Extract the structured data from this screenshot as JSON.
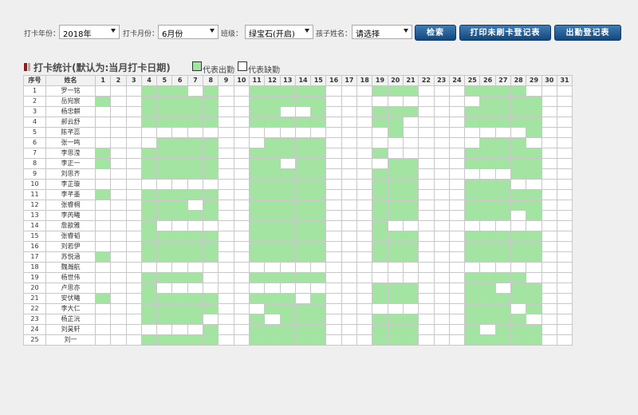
{
  "filters": {
    "year": {
      "label": "打卡年份：",
      "value": "2018年"
    },
    "month": {
      "label": "打卡月份：",
      "value": "6月份"
    },
    "class": {
      "label": "班级：",
      "value": "绿宝石(开启)"
    },
    "child": {
      "label": "孩子姓名：",
      "value": "请选择"
    }
  },
  "buttons": {
    "search": "检索",
    "print_unchecked": "打印未刷卡登记表",
    "attendance_register": "出勤登记表"
  },
  "title": "打卡统计(默认为:当月打卡日期)",
  "legend": {
    "present": "代表出勤",
    "absent": "代表缺勤"
  },
  "colors": {
    "present": "#a3e4a3",
    "absent": "#ffffff"
  },
  "table": {
    "header_index": "序号",
    "header_name": "姓名",
    "days": [
      "1",
      "2",
      "3",
      "4",
      "5",
      "6",
      "7",
      "8",
      "9",
      "10",
      "11",
      "12",
      "13",
      "14",
      "15",
      "16",
      "17",
      "18",
      "19",
      "20",
      "21",
      "22",
      "23",
      "24",
      "25",
      "26",
      "27",
      "28",
      "29",
      "30",
      "31"
    ],
    "rows": [
      {
        "no": "1",
        "name": "罗一铭",
        "days": [
          0,
          0,
          0,
          1,
          1,
          1,
          0,
          1,
          0,
          0,
          1,
          1,
          1,
          1,
          1,
          0,
          0,
          0,
          1,
          1,
          1,
          0,
          0,
          0,
          1,
          1,
          1,
          1,
          0,
          0,
          0
        ]
      },
      {
        "no": "2",
        "name": "岳宛宸",
        "days": [
          1,
          0,
          0,
          1,
          1,
          1,
          1,
          1,
          0,
          0,
          1,
          1,
          1,
          1,
          1,
          0,
          0,
          0,
          0,
          0,
          0,
          0,
          0,
          0,
          0,
          1,
          1,
          1,
          1,
          0,
          0
        ]
      },
      {
        "no": "3",
        "name": "杨忠麒",
        "days": [
          0,
          0,
          0,
          1,
          1,
          1,
          1,
          1,
          0,
          0,
          1,
          1,
          0,
          0,
          1,
          0,
          0,
          0,
          1,
          1,
          1,
          0,
          0,
          0,
          1,
          1,
          1,
          1,
          1,
          0,
          0
        ]
      },
      {
        "no": "4",
        "name": "郝云舒",
        "days": [
          0,
          0,
          0,
          1,
          1,
          1,
          1,
          1,
          0,
          0,
          1,
          1,
          1,
          1,
          1,
          0,
          0,
          0,
          1,
          1,
          0,
          0,
          0,
          0,
          1,
          1,
          1,
          1,
          1,
          0,
          0
        ]
      },
      {
        "no": "5",
        "name": "陈芊蕊",
        "days": [
          0,
          0,
          0,
          0,
          0,
          0,
          0,
          0,
          0,
          0,
          0,
          0,
          0,
          0,
          0,
          0,
          0,
          0,
          0,
          1,
          0,
          0,
          0,
          0,
          0,
          0,
          0,
          0,
          1,
          0,
          0
        ]
      },
      {
        "no": "6",
        "name": "张一鸣",
        "days": [
          0,
          0,
          0,
          0,
          1,
          1,
          1,
          1,
          0,
          0,
          0,
          1,
          1,
          1,
          1,
          0,
          0,
          0,
          0,
          0,
          0,
          0,
          0,
          0,
          0,
          1,
          1,
          1,
          0,
          0,
          0
        ]
      },
      {
        "no": "7",
        "name": "李思滢",
        "days": [
          1,
          0,
          0,
          1,
          1,
          1,
          1,
          1,
          0,
          0,
          1,
          1,
          1,
          1,
          1,
          0,
          0,
          0,
          1,
          0,
          0,
          0,
          0,
          0,
          1,
          1,
          1,
          1,
          1,
          0,
          0
        ]
      },
      {
        "no": "8",
        "name": "李正一",
        "days": [
          1,
          0,
          0,
          1,
          1,
          1,
          1,
          1,
          0,
          0,
          1,
          1,
          0,
          1,
          1,
          0,
          0,
          0,
          0,
          1,
          1,
          0,
          0,
          0,
          1,
          1,
          1,
          1,
          1,
          0,
          0
        ]
      },
      {
        "no": "9",
        "name": "刘思齐",
        "days": [
          0,
          0,
          0,
          1,
          1,
          1,
          1,
          1,
          0,
          0,
          1,
          1,
          1,
          1,
          1,
          0,
          0,
          0,
          1,
          1,
          1,
          0,
          0,
          0,
          0,
          0,
          0,
          1,
          1,
          0,
          0
        ]
      },
      {
        "no": "10",
        "name": "李芷璇",
        "days": [
          0,
          0,
          0,
          0,
          0,
          0,
          0,
          0,
          0,
          0,
          1,
          1,
          1,
          1,
          1,
          0,
          0,
          0,
          1,
          1,
          1,
          0,
          0,
          0,
          1,
          1,
          1,
          0,
          0,
          0,
          0
        ]
      },
      {
        "no": "11",
        "name": "李芊墨",
        "days": [
          1,
          0,
          0,
          1,
          1,
          1,
          1,
          1,
          0,
          0,
          1,
          1,
          1,
          1,
          1,
          0,
          0,
          0,
          1,
          1,
          1,
          0,
          0,
          0,
          1,
          1,
          1,
          1,
          1,
          0,
          0
        ]
      },
      {
        "no": "12",
        "name": "张睿桐",
        "days": [
          0,
          0,
          0,
          1,
          1,
          1,
          0,
          1,
          0,
          0,
          1,
          1,
          1,
          1,
          1,
          0,
          0,
          0,
          1,
          1,
          1,
          0,
          0,
          0,
          1,
          1,
          1,
          1,
          1,
          0,
          0
        ]
      },
      {
        "no": "13",
        "name": "李芮曦",
        "days": [
          0,
          0,
          0,
          1,
          1,
          1,
          1,
          1,
          0,
          0,
          1,
          1,
          1,
          1,
          1,
          0,
          0,
          0,
          1,
          1,
          1,
          0,
          0,
          0,
          1,
          1,
          1,
          0,
          1,
          0,
          0
        ]
      },
      {
        "no": "14",
        "name": "詹歆雅",
        "days": [
          0,
          0,
          0,
          1,
          0,
          0,
          0,
          0,
          0,
          0,
          1,
          1,
          1,
          1,
          1,
          0,
          0,
          0,
          1,
          0,
          0,
          0,
          0,
          0,
          0,
          0,
          0,
          0,
          0,
          0,
          0
        ]
      },
      {
        "no": "15",
        "name": "张睿韬",
        "days": [
          0,
          0,
          0,
          1,
          1,
          1,
          1,
          1,
          0,
          0,
          1,
          1,
          1,
          1,
          1,
          0,
          0,
          0,
          1,
          1,
          1,
          0,
          0,
          0,
          1,
          1,
          1,
          1,
          1,
          0,
          0
        ]
      },
      {
        "no": "16",
        "name": "刘若伊",
        "days": [
          0,
          0,
          0,
          1,
          1,
          1,
          1,
          1,
          0,
          0,
          1,
          1,
          1,
          1,
          1,
          0,
          0,
          0,
          1,
          1,
          1,
          0,
          0,
          0,
          1,
          1,
          1,
          1,
          1,
          0,
          0
        ]
      },
      {
        "no": "17",
        "name": "苏悦涵",
        "days": [
          1,
          0,
          0,
          1,
          1,
          1,
          1,
          1,
          0,
          0,
          1,
          1,
          1,
          1,
          1,
          0,
          0,
          0,
          1,
          1,
          1,
          0,
          0,
          0,
          1,
          1,
          1,
          1,
          1,
          0,
          0
        ]
      },
      {
        "no": "18",
        "name": "魏瀚航",
        "days": [
          0,
          0,
          0,
          0,
          0,
          0,
          0,
          0,
          0,
          0,
          0,
          0,
          0,
          0,
          0,
          0,
          0,
          0,
          0,
          0,
          0,
          0,
          0,
          0,
          0,
          0,
          0,
          0,
          0,
          0,
          0
        ]
      },
      {
        "no": "19",
        "name": "杨世伟",
        "days": [
          0,
          0,
          0,
          1,
          1,
          1,
          1,
          0,
          0,
          0,
          1,
          1,
          1,
          1,
          1,
          0,
          0,
          0,
          0,
          0,
          0,
          0,
          0,
          0,
          1,
          1,
          1,
          1,
          0,
          0,
          0
        ]
      },
      {
        "no": "20",
        "name": "卢思亦",
        "days": [
          0,
          0,
          0,
          1,
          0,
          0,
          0,
          0,
          0,
          0,
          0,
          0,
          0,
          0,
          0,
          0,
          0,
          0,
          1,
          1,
          1,
          0,
          0,
          0,
          1,
          1,
          0,
          1,
          1,
          0,
          0
        ]
      },
      {
        "no": "21",
        "name": "安伏曦",
        "days": [
          1,
          0,
          0,
          1,
          1,
          1,
          1,
          1,
          0,
          0,
          1,
          1,
          1,
          0,
          1,
          0,
          0,
          0,
          1,
          1,
          1,
          0,
          0,
          0,
          1,
          1,
          1,
          1,
          1,
          0,
          0
        ]
      },
      {
        "no": "22",
        "name": "李大仁",
        "days": [
          0,
          0,
          0,
          1,
          1,
          1,
          1,
          1,
          0,
          0,
          0,
          1,
          1,
          1,
          1,
          0,
          0,
          0,
          0,
          0,
          0,
          0,
          0,
          0,
          1,
          1,
          1,
          0,
          1,
          0,
          0
        ]
      },
      {
        "no": "23",
        "name": "杨芷沅",
        "days": [
          0,
          0,
          0,
          1,
          1,
          1,
          1,
          0,
          0,
          0,
          1,
          0,
          1,
          1,
          1,
          0,
          0,
          0,
          1,
          1,
          1,
          0,
          0,
          0,
          1,
          1,
          1,
          1,
          0,
          0,
          0
        ]
      },
      {
        "no": "24",
        "name": "刘昊轩",
        "days": [
          0,
          0,
          0,
          0,
          0,
          0,
          0,
          1,
          0,
          0,
          1,
          1,
          1,
          1,
          1,
          0,
          0,
          0,
          1,
          1,
          1,
          0,
          0,
          0,
          1,
          0,
          1,
          1,
          1,
          0,
          0
        ]
      },
      {
        "no": "25",
        "name": "刘一",
        "days": [
          0,
          0,
          0,
          1,
          1,
          1,
          1,
          1,
          0,
          0,
          1,
          1,
          1,
          1,
          1,
          0,
          0,
          0,
          1,
          1,
          1,
          0,
          0,
          0,
          1,
          1,
          1,
          1,
          1,
          0,
          0
        ]
      }
    ]
  }
}
